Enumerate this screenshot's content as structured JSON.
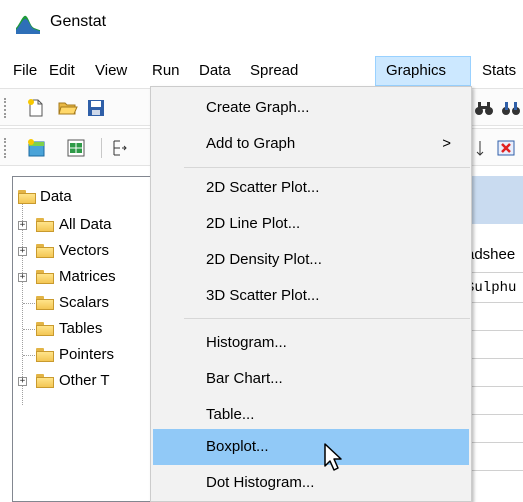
{
  "window": {
    "title": "Genstat"
  },
  "menubar": {
    "items": [
      {
        "label": "File"
      },
      {
        "label": "Edit"
      },
      {
        "label": "View"
      },
      {
        "label": "Run"
      },
      {
        "label": "Data"
      },
      {
        "label": "Spread"
      },
      {
        "label": "Graphics",
        "active": true
      },
      {
        "label": "Stats"
      }
    ]
  },
  "graphics_menu": {
    "items": [
      {
        "label": "Create Graph..."
      },
      {
        "label": "Add to Graph",
        "submenu_arrow": ">"
      },
      {
        "label": "2D Scatter Plot..."
      },
      {
        "label": "2D Line Plot..."
      },
      {
        "label": "2D Density Plot..."
      },
      {
        "label": "3D Scatter Plot..."
      },
      {
        "label": "Histogram..."
      },
      {
        "label": "Bar Chart..."
      },
      {
        "label": "Table..."
      },
      {
        "label": "Boxplot...",
        "hovered": true
      },
      {
        "label": "Dot Histogram..."
      }
    ]
  },
  "tree": {
    "root": "Data",
    "items": [
      {
        "label": "All Data",
        "expandable": true
      },
      {
        "label": "Vectors",
        "expandable": true
      },
      {
        "label": "Matrices",
        "expandable": true
      },
      {
        "label": "Scalars",
        "expandable": false
      },
      {
        "label": "Tables",
        "expandable": false
      },
      {
        "label": "Pointers",
        "expandable": false
      },
      {
        "label": "Other T",
        "expandable": true
      }
    ]
  },
  "spreadsheet": {
    "title_fragment": "adshee",
    "column_fragment": "Sulphu"
  },
  "colors": {
    "menu_active_bg": "#cce8ff",
    "menu_hover_bg": "#91c9f7",
    "dropdown_bg": "#f2f2f2",
    "sheet_header_bg": "#c9dbf0"
  }
}
